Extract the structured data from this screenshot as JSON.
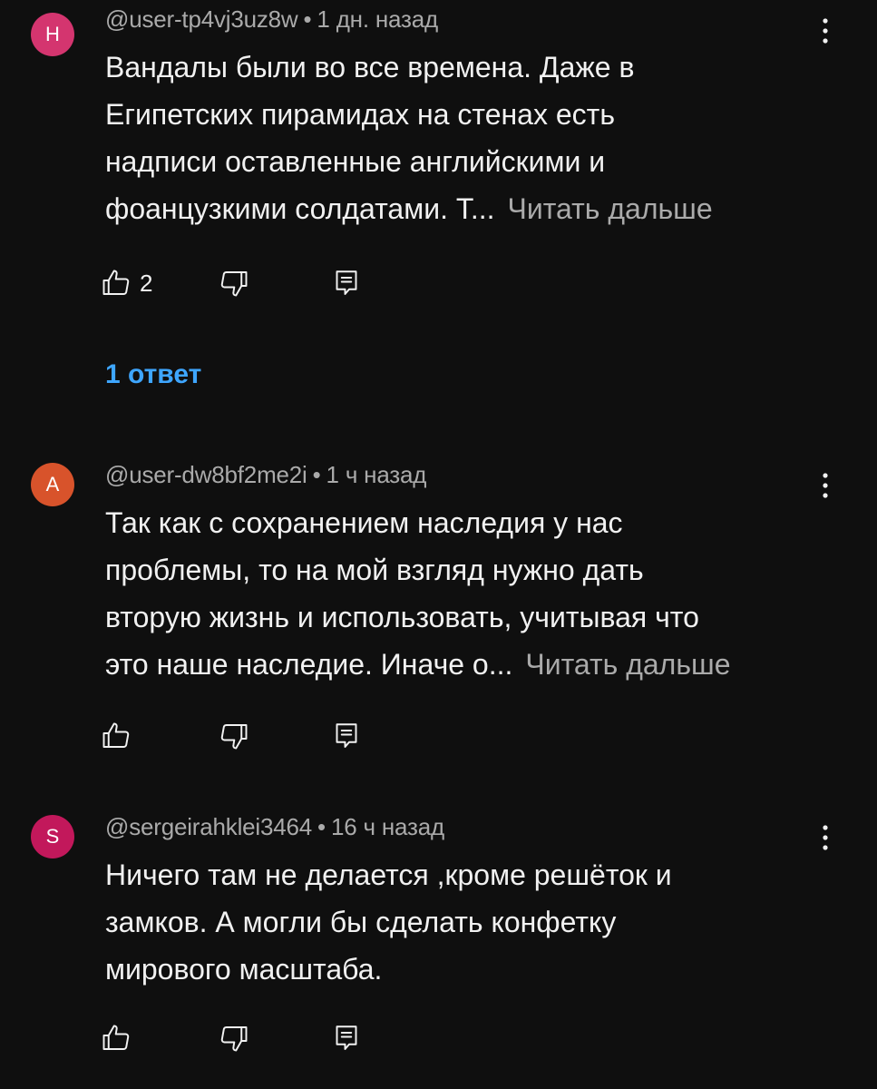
{
  "colors": {
    "background": "#0f0f0f",
    "text": "#f1f1f1",
    "secondary_text": "#aaaaaa",
    "link": "#3ea6ff"
  },
  "comments": [
    {
      "avatar_letter": "Н",
      "avatar_color": "#d4356f",
      "handle": "@user-tp4vj3uz8w",
      "separator": "•",
      "time": "1 дн. назад",
      "lines": [
        "Вандалы были во все времена. Даже в",
        "Египетских пирамидах на стенах есть",
        "надписи оставленные английскими и",
        "фоанцузкими солдатами. Т..."
      ],
      "read_more": "Читать дальше",
      "like_count": "2",
      "icons": {
        "menu": "more-vertical-icon",
        "like": "thumbs-up-icon",
        "dislike": "thumbs-down-icon",
        "reply": "reply-comment-icon"
      }
    },
    {
      "avatar_letter": "А",
      "avatar_color": "#d8532b",
      "handle": "@user-dw8bf2me2i",
      "separator": "•",
      "time": "1 ч назад",
      "lines": [
        "Так как с сохранением наследия у нас",
        "проблемы, то на мой взгляд нужно дать",
        "вторую жизнь и использовать, учитывая что",
        "это наше наследие. Иначе о..."
      ],
      "read_more": "Читать дальше",
      "like_count": "",
      "icons": {
        "menu": "more-vertical-icon",
        "like": "thumbs-up-icon",
        "dislike": "thumbs-down-icon",
        "reply": "reply-comment-icon"
      }
    },
    {
      "avatar_letter": "S",
      "avatar_color": "#c2185b",
      "handle": "@sergeirahklei3464",
      "separator": "•",
      "time": "16 ч назад",
      "lines": [
        "Ничего там не делается ,кроме решёток  и",
        "замков. А могли бы сделать конфетку",
        "мирового масштаба."
      ],
      "read_more": "",
      "like_count": "",
      "icons": {
        "menu": "more-vertical-icon",
        "like": "thumbs-up-icon",
        "dislike": "thumbs-down-icon",
        "reply": "reply-comment-icon"
      }
    }
  ],
  "replies_link": "1 ответ"
}
